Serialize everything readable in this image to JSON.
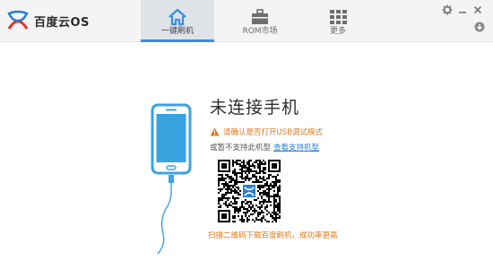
{
  "app": {
    "name": "百度云OS"
  },
  "tabs": [
    {
      "label": "一键刷机",
      "icon": "home-icon",
      "active": true
    },
    {
      "label": "ROM市场",
      "icon": "briefcase-icon",
      "active": false
    },
    {
      "label": "更多",
      "icon": "grid-icon",
      "active": false
    }
  ],
  "window_controls": {
    "settings": "gear-icon",
    "minimize": "minimize-icon",
    "close": "close-icon",
    "download": "download-icon"
  },
  "status": {
    "headline": "未连接手机",
    "warning": "请确认是否打开USB调试模式",
    "unsupported_text": "或暂不支持此机型",
    "supported_link": "查看支持机型",
    "scan_tip": "扫描二维码下载百度刷机，成功率更高"
  },
  "colors": {
    "accent": "#3a8ee6",
    "warning": "#e07a20",
    "link": "#2a7fd4",
    "phone": "#3aa3e0"
  }
}
